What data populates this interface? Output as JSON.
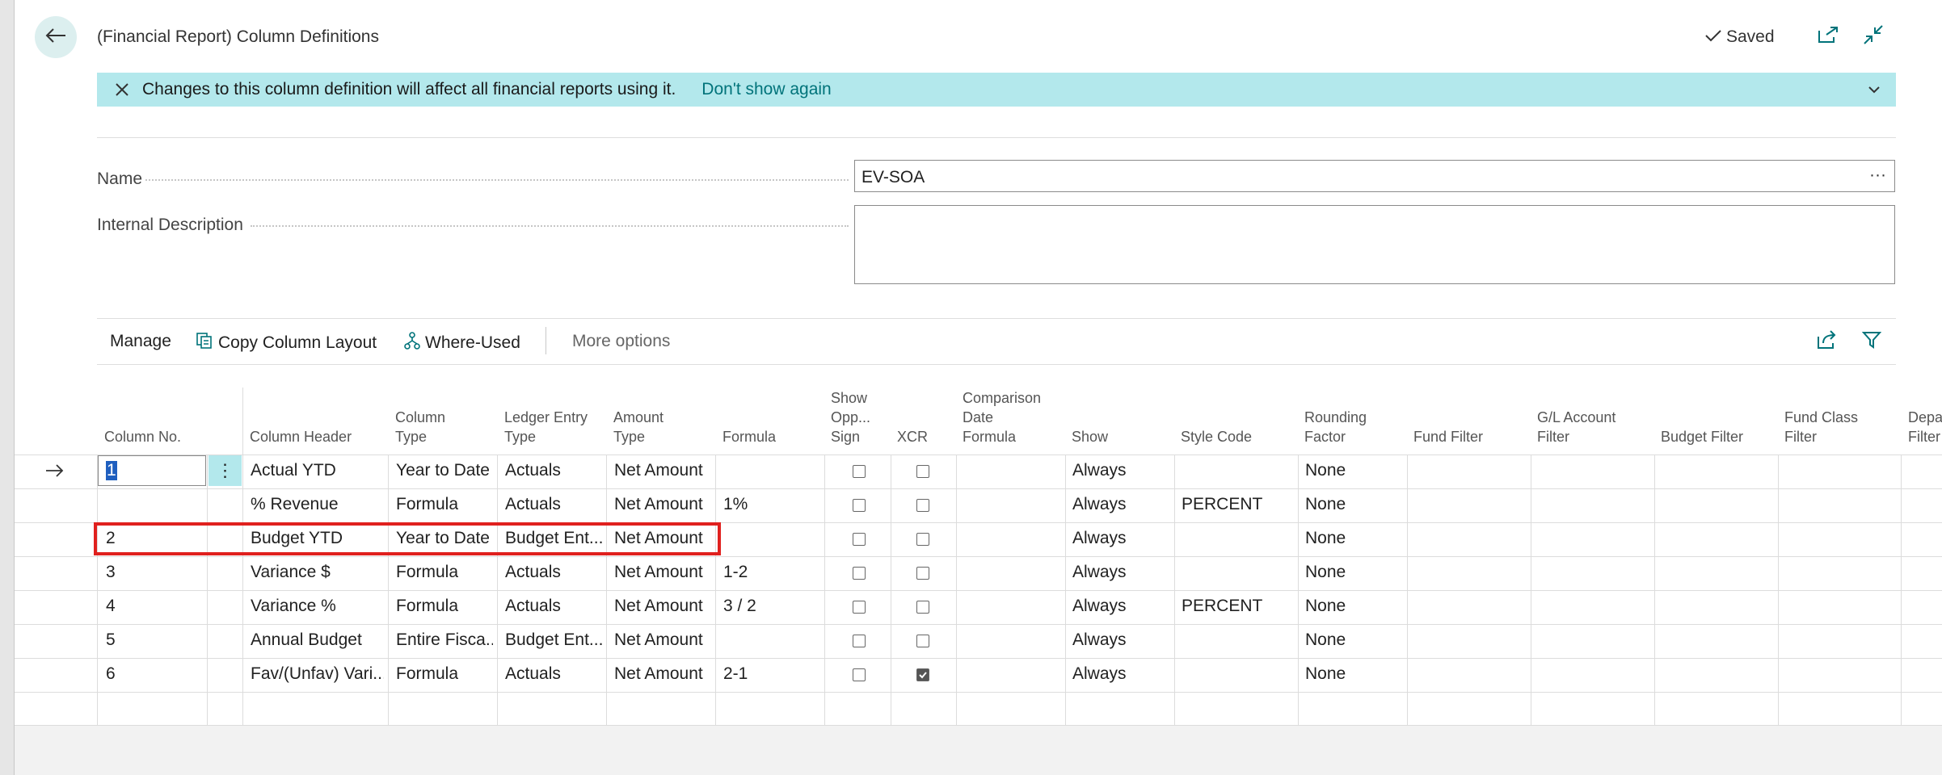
{
  "header": {
    "title": "(Financial Report) Column Definitions",
    "saved_label": "Saved"
  },
  "banner": {
    "message": "Changes to this column definition will affect all financial reports using it.",
    "link": "Don't show again"
  },
  "fields": {
    "name_label": "Name",
    "name_value": "EV-SOA",
    "name_ellipsis": "···",
    "description_label": "Internal Description"
  },
  "toolbar": {
    "manage": "Manage",
    "copy": "Copy Column Layout",
    "where_used": "Where-Used",
    "more": "More options"
  },
  "columns": {
    "col_no": [
      "Column No."
    ],
    "header": [
      "Column Header"
    ],
    "type": [
      "Column",
      "Type"
    ],
    "ledger": [
      "Ledger Entry",
      "Type"
    ],
    "amount": [
      "Amount",
      "Type"
    ],
    "formula": [
      "Formula"
    ],
    "show_opp": [
      "Show",
      "Opp...",
      "Sign"
    ],
    "xcr": [
      "XCR"
    ],
    "comparison": [
      "Comparison",
      "Date",
      "Formula"
    ],
    "show": [
      "Show"
    ],
    "style": [
      "Style Code"
    ],
    "rounding": [
      "Rounding",
      "Factor"
    ],
    "fund": [
      "Fund Filter"
    ],
    "gl": [
      "G/L Account",
      "Filter"
    ],
    "budget": [
      "Budget Filter"
    ],
    "fund_class": [
      "Fund Class",
      "Filter"
    ],
    "dept": [
      "Depa",
      "Filter"
    ]
  },
  "rows": [
    {
      "no": "1",
      "header": "Actual YTD",
      "type": "Year to Date",
      "ledger": "Actuals",
      "amount": "Net Amount",
      "formula": "",
      "opp": false,
      "xcr": false,
      "show": "Always",
      "style": "",
      "rounding": "None"
    },
    {
      "no": "",
      "header": "% Revenue",
      "type": "Formula",
      "ledger": "Actuals",
      "amount": "Net Amount",
      "formula": "1%",
      "opp": false,
      "xcr": false,
      "show": "Always",
      "style": "PERCENT",
      "rounding": "None"
    },
    {
      "no": "2",
      "header": "Budget YTD",
      "type": "Year to Date",
      "ledger": "Budget Ent...",
      "amount": "Net Amount",
      "formula": "",
      "opp": false,
      "xcr": false,
      "show": "Always",
      "style": "",
      "rounding": "None"
    },
    {
      "no": "3",
      "header": "Variance $",
      "type": "Formula",
      "ledger": "Actuals",
      "amount": "Net Amount",
      "formula": "1-2",
      "opp": false,
      "xcr": false,
      "show": "Always",
      "style": "",
      "rounding": "None"
    },
    {
      "no": "4",
      "header": "Variance %",
      "type": "Formula",
      "ledger": "Actuals",
      "amount": "Net Amount",
      "formula": "3 / 2",
      "opp": false,
      "xcr": false,
      "show": "Always",
      "style": "PERCENT",
      "rounding": "None"
    },
    {
      "no": "5",
      "header": "Annual Budget",
      "type": "Entire Fisca...",
      "ledger": "Budget Ent...",
      "amount": "Net Amount",
      "formula": "",
      "opp": false,
      "xcr": false,
      "show": "Always",
      "style": "",
      "rounding": "None"
    },
    {
      "no": "6",
      "header": "Fav/(Unfav) Vari...",
      "type": "Formula",
      "ledger": "Actuals",
      "amount": "Net Amount",
      "formula": "2-1",
      "opp": false,
      "xcr": true,
      "show": "Always",
      "style": "",
      "rounding": "None"
    }
  ]
}
